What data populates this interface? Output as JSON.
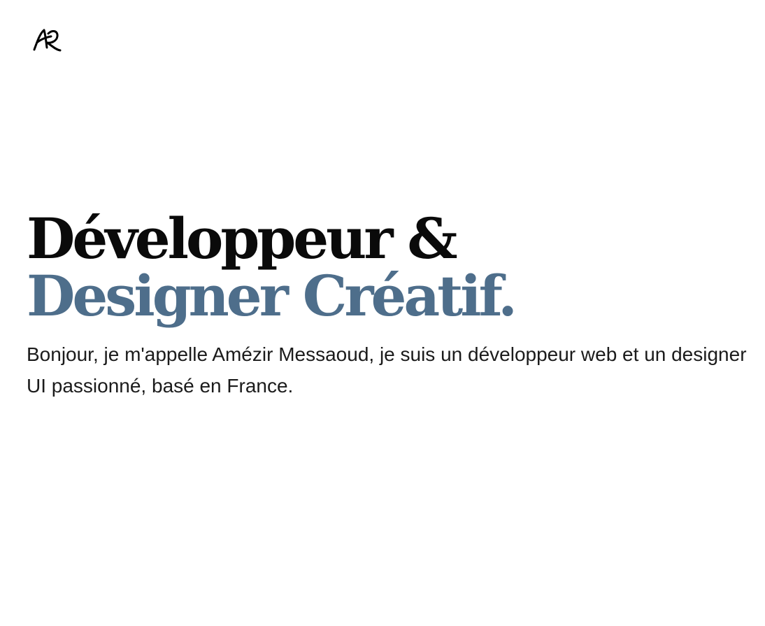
{
  "logo": {
    "icon": "ae-monogram-logo",
    "alt": "AM"
  },
  "hero": {
    "headline_line1": "Développeur &",
    "headline_line2": "Designer Créatif.",
    "intro": "Bonjour, je m'appelle Amézir Messaoud, je suis un développeur web et un designer UI passionné, basé en France."
  },
  "colors": {
    "background": "#ffffff",
    "text": "#0a0a0a",
    "accent": "#4e6e8b"
  }
}
